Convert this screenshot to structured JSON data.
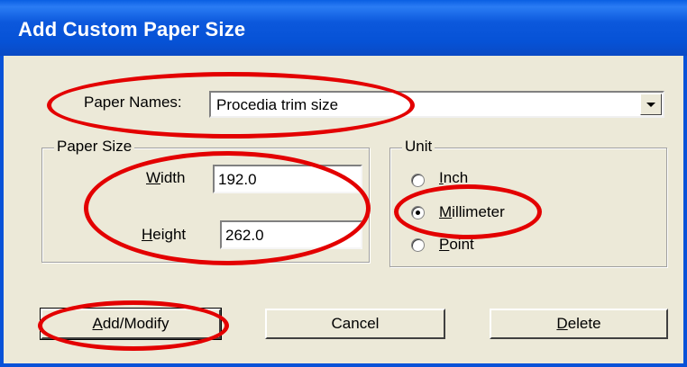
{
  "dialog": {
    "title": "Add Custom Paper Size"
  },
  "paper_names": {
    "label": "Paper Names:",
    "value": "Procedia trim size",
    "dropdown_icon": "chevron-down-icon"
  },
  "paper_size": {
    "group_title": "Paper Size",
    "width_label": "Width",
    "width_value": "192.0",
    "height_label": "Height",
    "height_value": "262.0"
  },
  "unit": {
    "group_title": "Unit",
    "options": [
      {
        "label": "Inch",
        "checked": false
      },
      {
        "label": "Millimeter",
        "checked": true
      },
      {
        "label": "Point",
        "checked": false
      }
    ]
  },
  "buttons": {
    "add_modify": "Add/Modify",
    "cancel": "Cancel",
    "delete": "Delete"
  },
  "annotations": {
    "highlight_color": "#e30000"
  }
}
